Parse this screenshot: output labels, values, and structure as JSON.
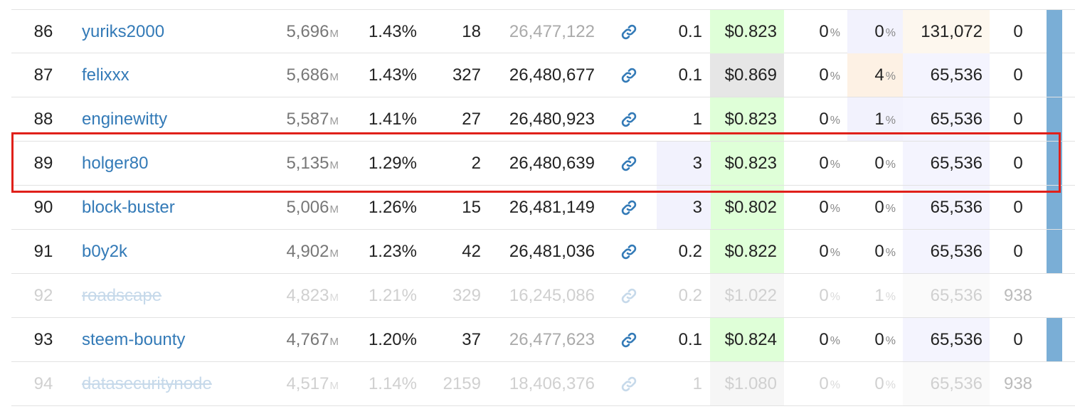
{
  "rows": [
    {
      "rank": "86",
      "name": "yuriks2000",
      "vests": "5,696",
      "vests_unit": "M",
      "pct": "1.43%",
      "missed": "18",
      "block": "26,477,122",
      "block_grey": true,
      "version": "0.1",
      "price": "$0.823",
      "apr": "0",
      "apr_unit": "%",
      "interest": "0",
      "interest_unit": "%",
      "block_size": "131,072",
      "fee": "0",
      "disabled": false,
      "icon": "link-icon"
    },
    {
      "rank": "87",
      "name": "felixxx",
      "vests": "5,686",
      "vests_unit": "M",
      "pct": "1.43%",
      "missed": "327",
      "block": "26,480,677",
      "block_grey": false,
      "version": "0.1",
      "price": "$0.869",
      "apr": "0",
      "apr_unit": "%",
      "interest": "4",
      "interest_unit": "%",
      "block_size": "65,536",
      "fee": "0",
      "disabled": false,
      "icon": "link-icon"
    },
    {
      "rank": "88",
      "name": "enginewitty",
      "vests": "5,587",
      "vests_unit": "M",
      "pct": "1.41%",
      "missed": "27",
      "block": "26,480,923",
      "block_grey": false,
      "version": "1",
      "price": "$0.823",
      "apr": "0",
      "apr_unit": "%",
      "interest": "1",
      "interest_unit": "%",
      "block_size": "65,536",
      "fee": "0",
      "disabled": false,
      "icon": "link-icon"
    },
    {
      "rank": "89",
      "name": "holger80",
      "vests": "5,135",
      "vests_unit": "M",
      "pct": "1.29%",
      "missed": "2",
      "block": "26,480,639",
      "block_grey": false,
      "version": "3",
      "price": "$0.823",
      "apr": "0",
      "apr_unit": "%",
      "interest": "0",
      "interest_unit": "%",
      "block_size": "65,536",
      "fee": "0",
      "disabled": false,
      "icon": "link-icon"
    },
    {
      "rank": "90",
      "name": "block-buster",
      "vests": "5,006",
      "vests_unit": "M",
      "pct": "1.26%",
      "missed": "15",
      "block": "26,481,149",
      "block_grey": false,
      "version": "3",
      "price": "$0.802",
      "apr": "0",
      "apr_unit": "%",
      "interest": "0",
      "interest_unit": "%",
      "block_size": "65,536",
      "fee": "0",
      "disabled": false,
      "icon": "link-icon"
    },
    {
      "rank": "91",
      "name": "b0y2k",
      "vests": "4,902",
      "vests_unit": "M",
      "pct": "1.23%",
      "missed": "42",
      "block": "26,481,036",
      "block_grey": false,
      "version": "0.2",
      "price": "$0.822",
      "apr": "0",
      "apr_unit": "%",
      "interest": "0",
      "interest_unit": "%",
      "block_size": "65,536",
      "fee": "0",
      "disabled": false,
      "icon": "link-icon"
    },
    {
      "rank": "92",
      "name": "roadscape",
      "vests": "4,823",
      "vests_unit": "M",
      "pct": "1.21%",
      "missed": "329",
      "block": "16,245,086",
      "block_grey": true,
      "version": "0.2",
      "price": "$1.022",
      "apr": "0",
      "apr_unit": "%",
      "interest": "1",
      "interest_unit": "%",
      "block_size": "65,536",
      "fee": "938",
      "disabled": true,
      "icon": "link-icon"
    },
    {
      "rank": "93",
      "name": "steem-bounty",
      "vests": "4,767",
      "vests_unit": "M",
      "pct": "1.20%",
      "missed": "37",
      "block": "26,477,623",
      "block_grey": true,
      "version": "0.1",
      "price": "$0.824",
      "apr": "0",
      "apr_unit": "%",
      "interest": "0",
      "interest_unit": "%",
      "block_size": "65,536",
      "fee": "0",
      "disabled": false,
      "icon": "link-icon"
    },
    {
      "rank": "94",
      "name": "datasecuritynode",
      "vests": "4,517",
      "vests_unit": "M",
      "pct": "1.14%",
      "missed": "2159",
      "block": "18,406,376",
      "block_grey": true,
      "version": "1",
      "price": "$1.080",
      "apr": "0",
      "apr_unit": "%",
      "interest": "0",
      "interest_unit": "%",
      "block_size": "65,536",
      "fee": "938",
      "disabled": true,
      "icon": "link-icon"
    }
  ],
  "colors": {
    "link": "#337ab7",
    "highlight_border": "#e0201a",
    "price_bg": "#dfffd8",
    "status_bar": "#7aaed6"
  },
  "highlighted_rank": "89"
}
